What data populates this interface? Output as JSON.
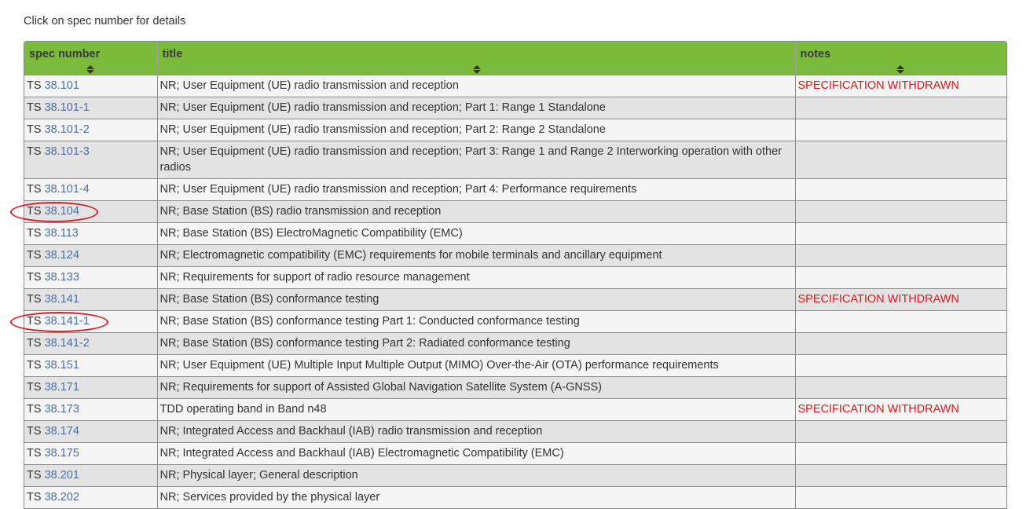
{
  "intro": "Click on spec number for details",
  "colors": {
    "header_bg": "#7cba3b",
    "link": "#4a6fa5",
    "withdrawn": "#e0151b",
    "highlight_ellipse": "#d4202a"
  },
  "columns": [
    "spec number",
    "title",
    "notes"
  ],
  "rows": [
    {
      "prefix": "TS",
      "number": "38.101",
      "title": "NR; User Equipment (UE) radio transmission and reception",
      "notes": "SPECIFICATION WITHDRAWN"
    },
    {
      "prefix": "TS",
      "number": "38.101-1",
      "title": "NR; User Equipment (UE) radio transmission and reception; Part 1: Range 1 Standalone",
      "notes": ""
    },
    {
      "prefix": "TS",
      "number": "38.101-2",
      "title": "NR; User Equipment (UE) radio transmission and reception; Part 2: Range 2 Standalone",
      "notes": ""
    },
    {
      "prefix": "TS",
      "number": "38.101-3",
      "title": "NR; User Equipment (UE) radio transmission and reception; Part 3: Range 1 and Range 2 Interworking operation with other radios",
      "notes": ""
    },
    {
      "prefix": "TS",
      "number": "38.101-4",
      "title": "NR; User Equipment (UE) radio transmission and reception; Part 4: Performance requirements",
      "notes": ""
    },
    {
      "prefix": "TS",
      "number": "38.104",
      "title": "NR; Base Station (BS) radio transmission and reception",
      "notes": "",
      "highlighted": true
    },
    {
      "prefix": "TS",
      "number": "38.113",
      "title": "NR; Base Station (BS) ElectroMagnetic Compatibility (EMC)",
      "notes": ""
    },
    {
      "prefix": "TS",
      "number": "38.124",
      "title": "NR; Electromagnetic compatibility (EMC) requirements for mobile terminals and ancillary equipment",
      "notes": ""
    },
    {
      "prefix": "TS",
      "number": "38.133",
      "title": "NR; Requirements for support of radio resource management",
      "notes": ""
    },
    {
      "prefix": "TS",
      "number": "38.141",
      "title": "NR; Base Station (BS) conformance testing",
      "notes": "SPECIFICATION WITHDRAWN"
    },
    {
      "prefix": "TS",
      "number": "38.141-1",
      "title": "NR; Base Station (BS) conformance testing Part 1: Conducted conformance testing",
      "notes": "",
      "highlighted": true
    },
    {
      "prefix": "TS",
      "number": "38.141-2",
      "title": "NR; Base Station (BS) conformance testing Part 2: Radiated conformance testing",
      "notes": ""
    },
    {
      "prefix": "TS",
      "number": "38.151",
      "title": "NR; User Equipment (UE) Multiple Input Multiple Output (MIMO) Over-the-Air (OTA) performance requirements",
      "notes": ""
    },
    {
      "prefix": "TS",
      "number": "38.171",
      "title": "NR; Requirements for support of Assisted Global Navigation Satellite System (A-GNSS)",
      "notes": ""
    },
    {
      "prefix": "TS",
      "number": "38.173",
      "title": "TDD operating band in Band n48",
      "notes": "SPECIFICATION WITHDRAWN"
    },
    {
      "prefix": "TS",
      "number": "38.174",
      "title": "NR; Integrated Access and Backhaul (IAB) radio transmission and reception",
      "notes": ""
    },
    {
      "prefix": "TS",
      "number": "38.175",
      "title": "NR; Integrated Access and Backhaul (IAB) Electromagnetic Compatibility (EMC)",
      "notes": ""
    },
    {
      "prefix": "TS",
      "number": "38.201",
      "title": "NR; Physical layer; General description",
      "notes": ""
    },
    {
      "prefix": "TS",
      "number": "38.202",
      "title": "NR; Services provided by the physical layer",
      "notes": ""
    }
  ]
}
